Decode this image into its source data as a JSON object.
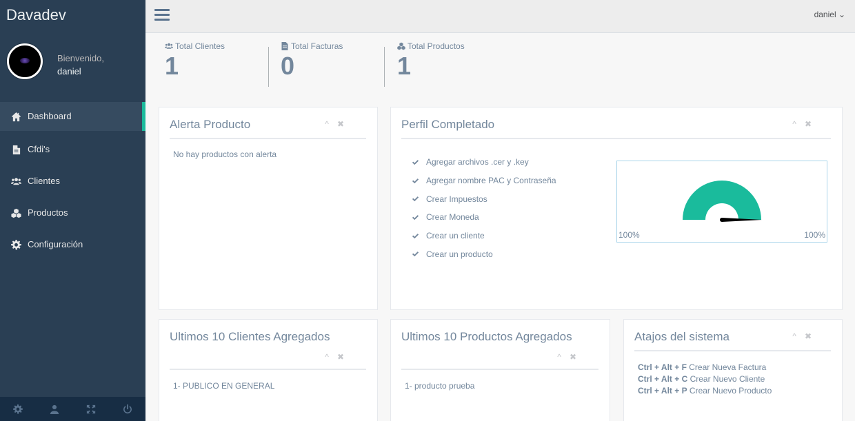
{
  "app": {
    "brand": "Davadev"
  },
  "profile": {
    "welcome": "Bienvenido,",
    "username": "daniel"
  },
  "sidebar": {
    "items": [
      {
        "label": "Dashboard",
        "icon": "home-icon",
        "active": true
      },
      {
        "label": "Cfdi's",
        "icon": "document-icon",
        "active": false
      },
      {
        "label": "Clientes",
        "icon": "users-icon",
        "active": false
      },
      {
        "label": "Productos",
        "icon": "cubes-icon",
        "active": false
      },
      {
        "label": "Configuración",
        "icon": "gear-icon",
        "active": false
      }
    ],
    "footer": [
      "settings-icon",
      "user-icon",
      "fullscreen-icon",
      "power-icon"
    ]
  },
  "topnav": {
    "user": "daniel ⌄"
  },
  "stats": [
    {
      "label": "Total Clientes",
      "value": "1",
      "icon": "users-icon"
    },
    {
      "label": "Total Facturas",
      "value": "0",
      "icon": "file-icon"
    },
    {
      "label": "Total Productos",
      "value": "1",
      "icon": "cubes-icon"
    }
  ],
  "panels": {
    "alerta": {
      "title": "Alerta Producto",
      "body": "No hay productos con alerta"
    },
    "perfil": {
      "title": "Perfil Completado",
      "checklist": [
        "Agregar archivos .cer y .key",
        "Agregar nombre PAC y Contraseña",
        "Crear Impuestos",
        "Crear Moneda",
        "Crear un cliente",
        "Crear un producto"
      ],
      "gauge": {
        "value": 100,
        "min_label": "100%",
        "max_label": "100%",
        "color": "#1abb9c"
      }
    },
    "clientes": {
      "title": "Ultimos 10 Clientes Agregados",
      "items": [
        "1- PUBLICO EN GENERAL"
      ]
    },
    "productos": {
      "title": "Ultimos 10 Productos Agregados",
      "items": [
        "1- producto prueba"
      ]
    },
    "atajos": {
      "title": "Atajos del sistema",
      "shortcuts": [
        {
          "keys": "Ctrl + Alt + F",
          "action": "Crear Nueva Factura"
        },
        {
          "keys": "Ctrl + Alt + C",
          "action": "Crear Nuevo Cliente"
        },
        {
          "keys": "Ctrl + Alt + P",
          "action": "Crear Nuevo Producto"
        }
      ]
    }
  },
  "tools": {
    "collapse": "^",
    "close": "✖"
  },
  "colors": {
    "sidebar": "#2a3f54",
    "accent": "#1abb9c",
    "text": "#73879c"
  }
}
